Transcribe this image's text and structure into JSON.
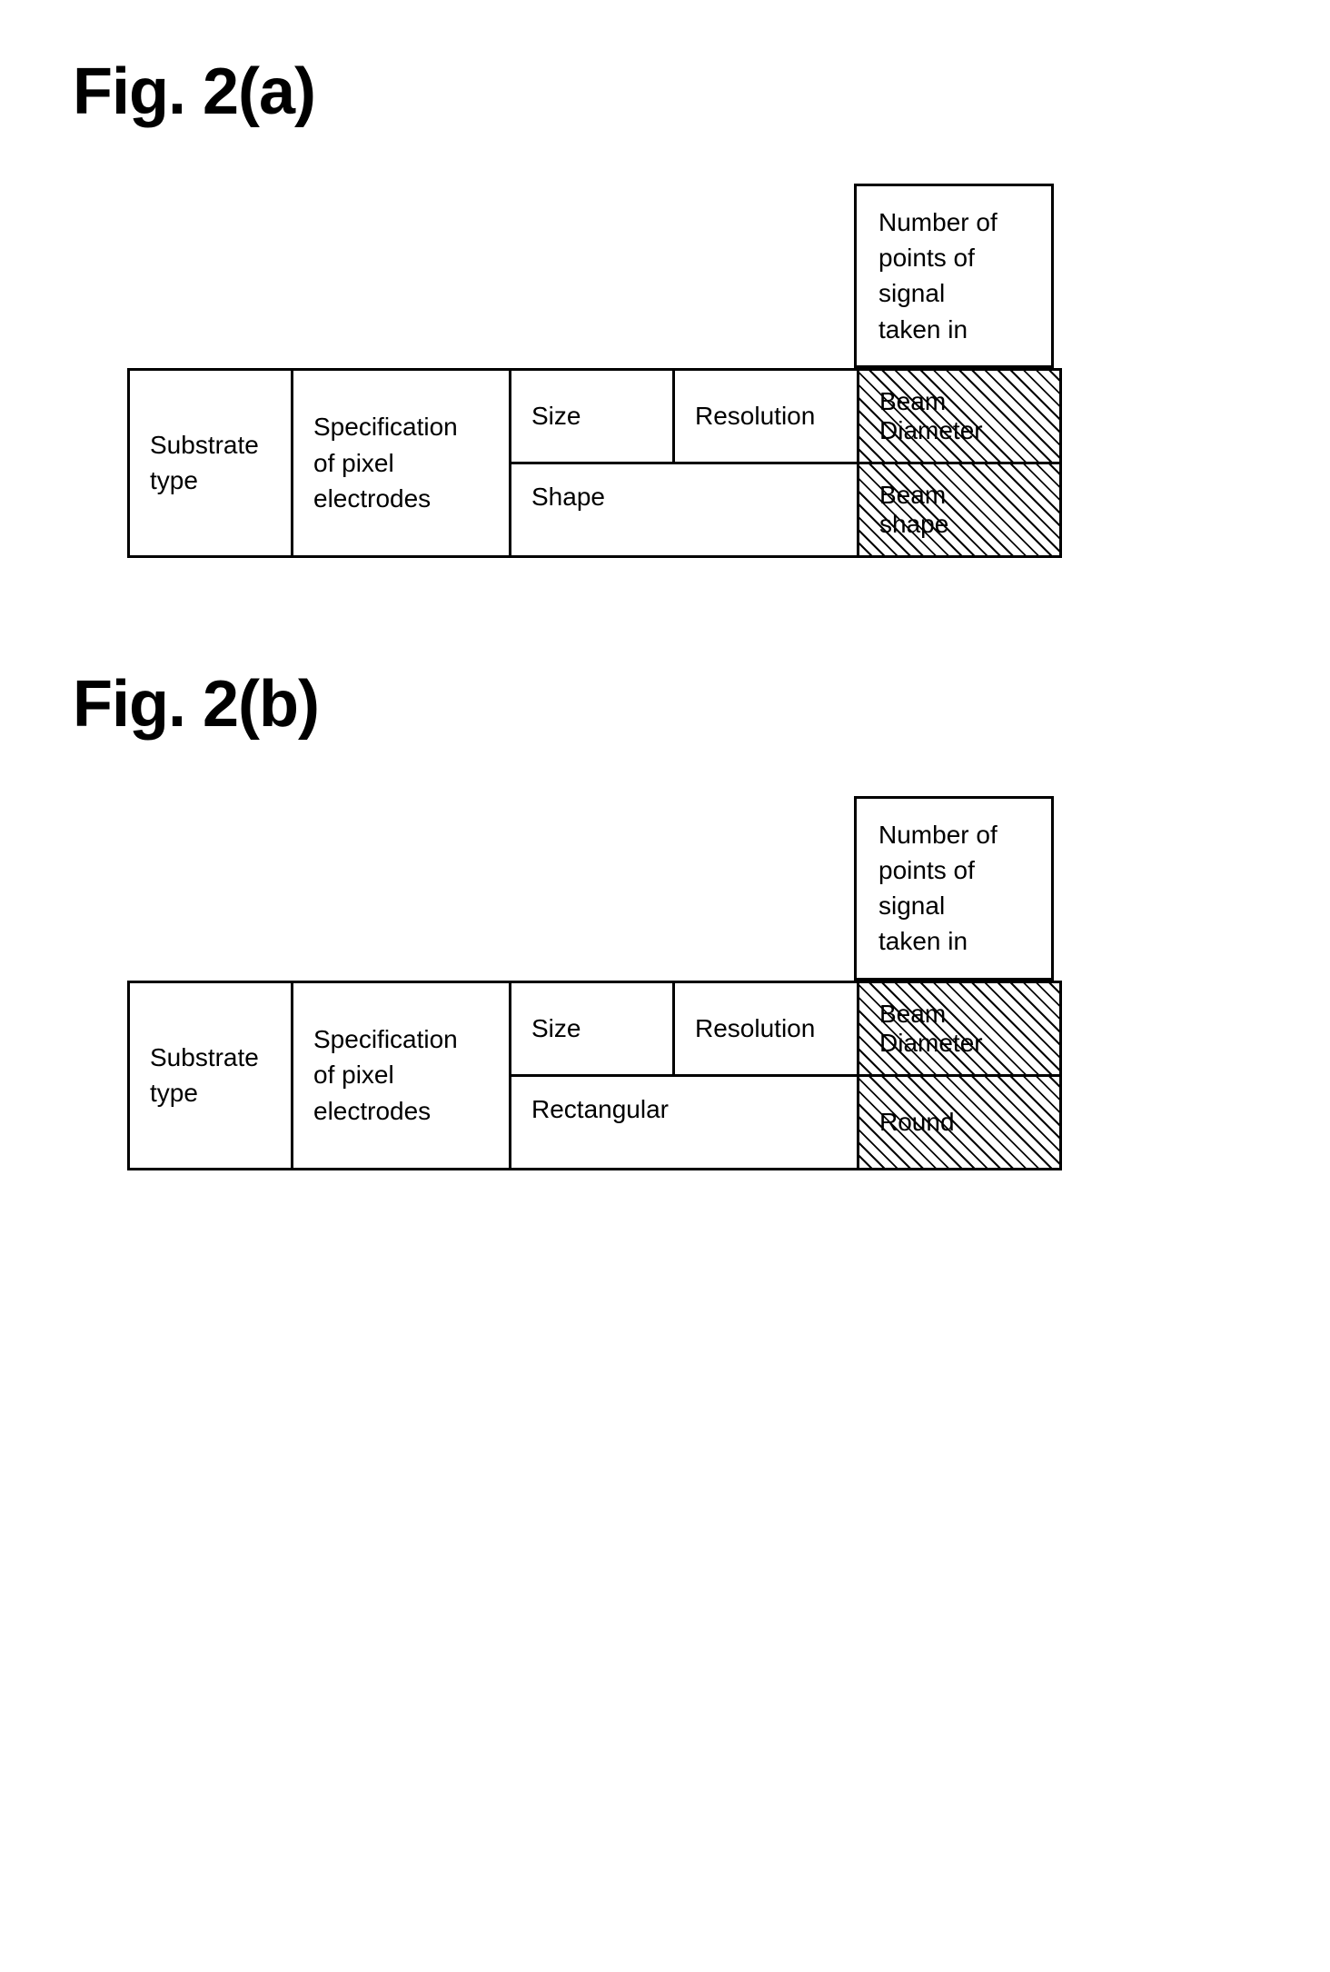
{
  "figureA": {
    "title": "Fig. 2(a)",
    "header": {
      "label": "Number of\npoints of\nsignal\ntaken in"
    },
    "table": {
      "substrate": "Substrate\ntype",
      "specification": "Specification\nof pixel\nelectrodes",
      "size": "Size",
      "resolution": "Resolution",
      "shape": "Shape",
      "beamDiameter": "Beam\nDiameter",
      "beamShape": "Beam\nshape"
    }
  },
  "figureB": {
    "title": "Fig. 2(b)",
    "header": {
      "label": "Number of\npoints of\nsignal\ntaken in"
    },
    "table": {
      "substrate": "Substrate\ntype",
      "specification": "Specification\nof pixel\nelectrodes",
      "size": "Size",
      "resolution": "Resolution",
      "rectangular": "Rectangular",
      "beamDiameter": "Beam\nDiameter",
      "round": "Round"
    }
  }
}
